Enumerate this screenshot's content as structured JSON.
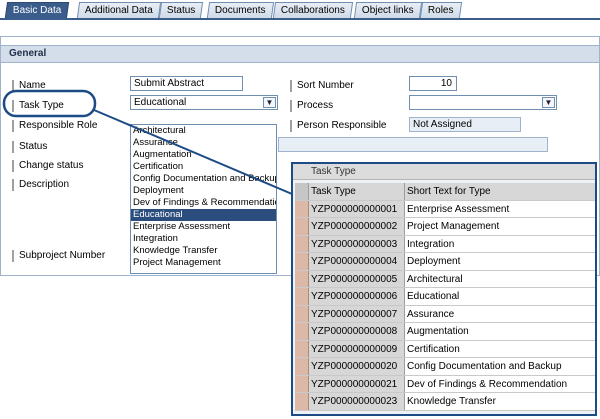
{
  "tabs": [
    {
      "label": "Basic Data",
      "active": true
    },
    {
      "label": "Additional Data",
      "active": false
    },
    {
      "label": "Status",
      "active": false
    },
    {
      "label": "Documents",
      "active": false
    },
    {
      "label": "Collaborations",
      "active": false
    },
    {
      "label": "Object links",
      "active": false
    },
    {
      "label": "Roles",
      "active": false
    }
  ],
  "general": {
    "header": "General",
    "name_label": "Name",
    "name_value": "Submit Abstract",
    "task_type_label": "Task Type",
    "task_type_value": "Educational",
    "responsible_role_label": "Responsible Role",
    "status_label": "Status",
    "change_status_label": "Change status",
    "description_label": "Description",
    "subproject_number_label": "Subproject Number",
    "sort_number_label": "Sort Number",
    "sort_number_value": "10",
    "process_label": "Process",
    "process_value": "",
    "person_responsible_label": "Person Responsible",
    "person_responsible_value": "Not Assigned"
  },
  "dropdown_options": [
    "Architectural",
    "Assurance",
    "Augmentation",
    "Certification",
    "Config Documentation and Backup",
    "Deployment",
    "Dev of Findings & Recommendation",
    "Educational",
    "Enterprise Assessment",
    "Integration",
    "Knowledge Transfer",
    "Project Management"
  ],
  "dropdown_selected": "Educational",
  "popup": {
    "title": "Task Type",
    "col_task_type": "Task Type",
    "col_short_text": "Short Text for Type",
    "rows": [
      {
        "code": "YZP000000000001",
        "text": "Enterprise Assessment"
      },
      {
        "code": "YZP000000000002",
        "text": "Project Management"
      },
      {
        "code": "YZP000000000003",
        "text": "Integration"
      },
      {
        "code": "YZP000000000004",
        "text": "Deployment"
      },
      {
        "code": "YZP000000000005",
        "text": "Architectural"
      },
      {
        "code": "YZP000000000006",
        "text": "Educational"
      },
      {
        "code": "YZP000000000007",
        "text": "Assurance"
      },
      {
        "code": "YZP000000000008",
        "text": "Augmentation"
      },
      {
        "code": "YZP000000000009",
        "text": "Certification"
      },
      {
        "code": "YZP000000000020",
        "text": "Config Documentation and Backup"
      },
      {
        "code": "YZP000000000021",
        "text": "Dev of Findings & Recommendation"
      },
      {
        "code": "YZP000000000023",
        "text": "Knowledge Transfer"
      }
    ]
  },
  "colors": {
    "tab_active": "#3a5d8c",
    "callout": "#1d4b86",
    "selection": "#2b4d7e"
  }
}
